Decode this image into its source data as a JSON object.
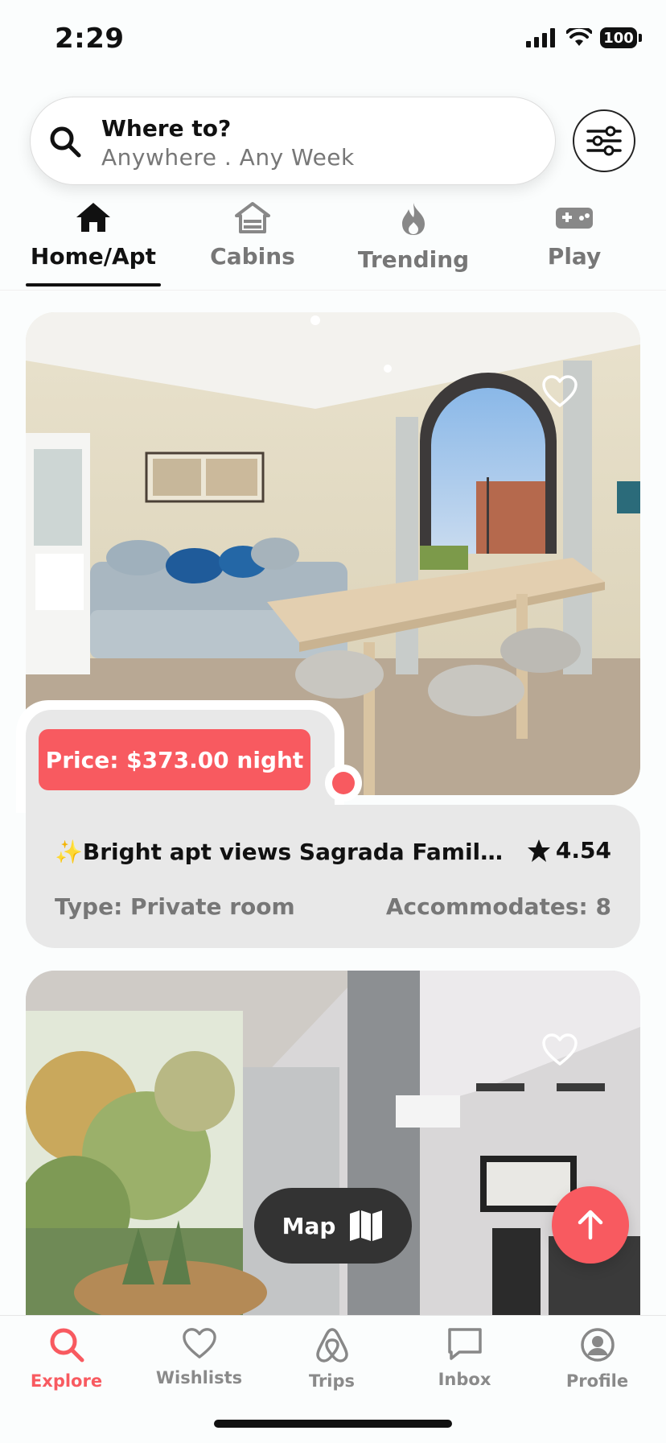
{
  "status_bar": {
    "time": "2:29",
    "battery": "100"
  },
  "search": {
    "title": "Where to?",
    "subtitle": "Anywhere . Any Week"
  },
  "categories": [
    {
      "label": "Home/Apt",
      "icon": "house-icon",
      "active": true
    },
    {
      "label": "Cabins",
      "icon": "cabin-icon",
      "active": false
    },
    {
      "label": "Trending",
      "icon": "fire-icon",
      "active": false
    },
    {
      "label": "Play",
      "icon": "gamepad-icon",
      "active": false
    }
  ],
  "listings": [
    {
      "price": "Price: $373.00 night",
      "title": "✨Bright apt views Sagrada Familia /...",
      "rating": "4.54",
      "type": "Type: Private room",
      "accommodates": "Accommodates: 8"
    }
  ],
  "floating": {
    "map_label": "Map"
  },
  "tabs": [
    {
      "label": "Explore",
      "icon": "search-icon",
      "active": true
    },
    {
      "label": "Wishlists",
      "icon": "heart-icon",
      "active": false
    },
    {
      "label": "Trips",
      "icon": "airbnb-logo-icon",
      "active": false
    },
    {
      "label": "Inbox",
      "icon": "chat-icon",
      "active": false
    },
    {
      "label": "Profile",
      "icon": "profile-icon",
      "active": false
    }
  ],
  "colors": {
    "accent": "#f85a60",
    "panel": "#e8e8e8",
    "muted": "#777777"
  }
}
